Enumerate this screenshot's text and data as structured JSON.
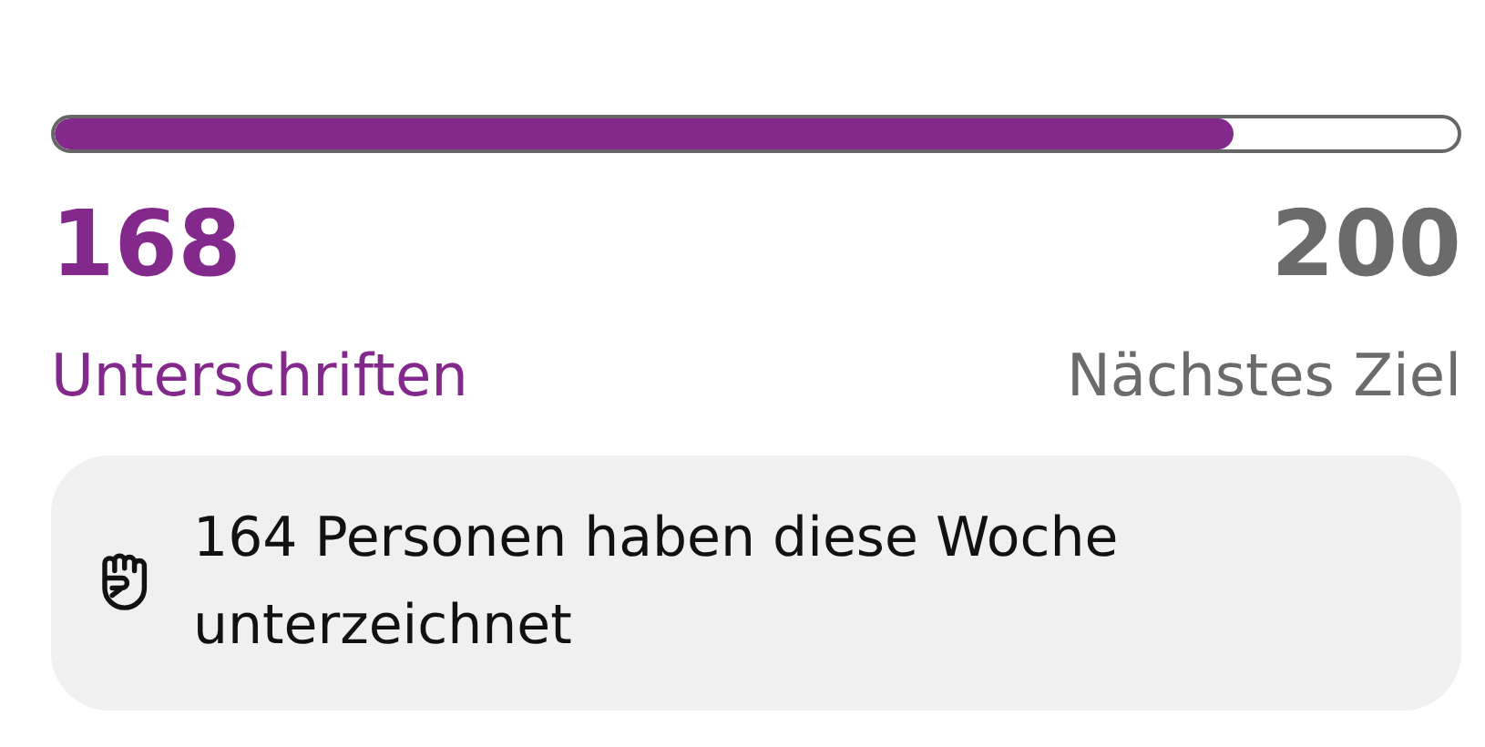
{
  "progress": {
    "level": 0.84
  },
  "current": {
    "count": "168",
    "label": "Unterschriften"
  },
  "goal": {
    "count": "200",
    "label": "Nächstes Ziel"
  },
  "notice": {
    "text": "164 Personen haben diese Woche unterzeichnet"
  }
}
